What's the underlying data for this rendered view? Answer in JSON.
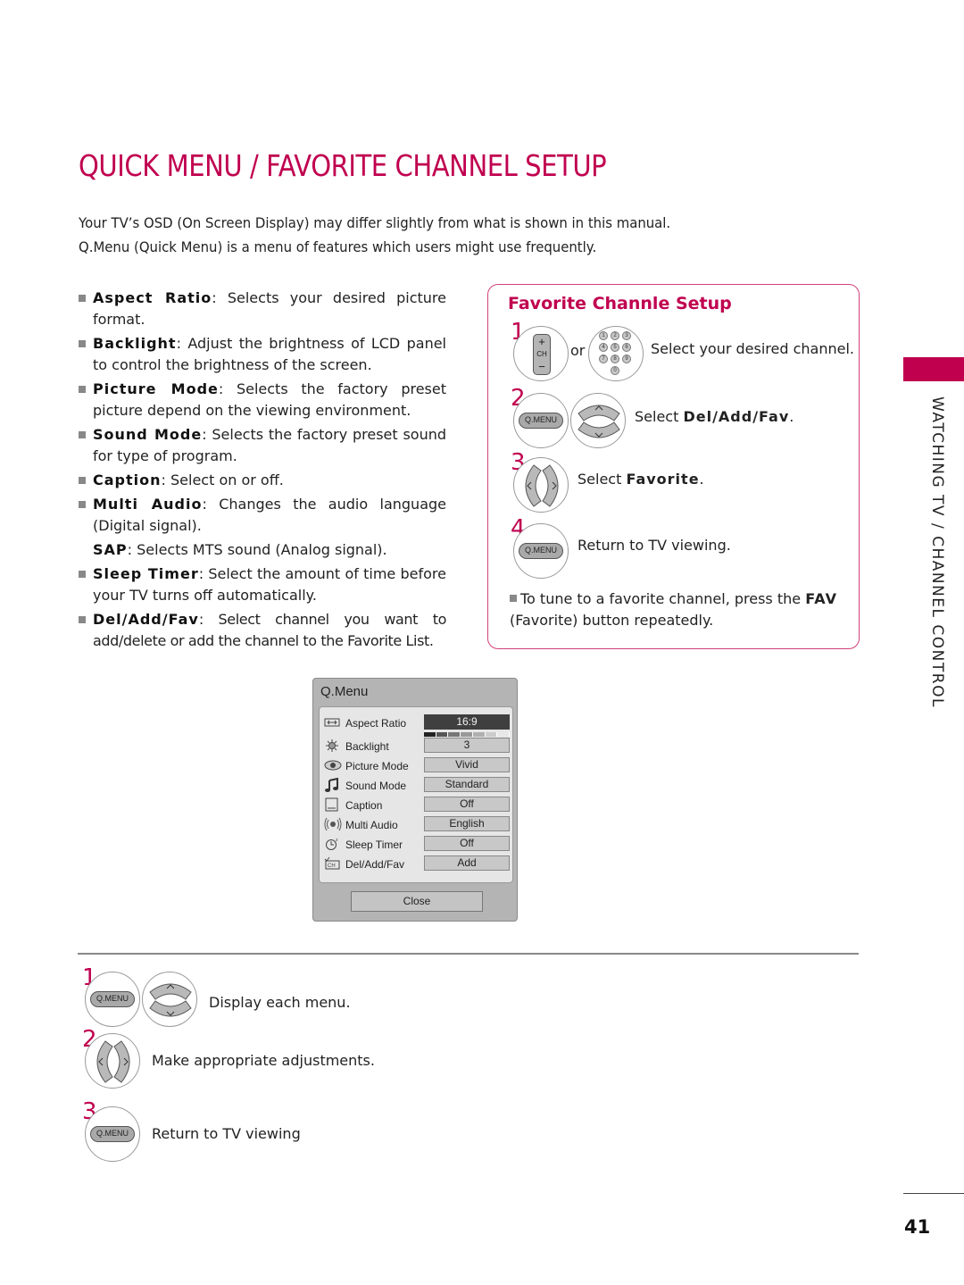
{
  "page": {
    "title": "QUICK MENU / FAVORITE CHANNEL SETUP",
    "intro": [
      "Your TV’s OSD (On Screen Display) may differ slightly from what is shown in this manual.",
      "Q.Menu (Quick Menu) is a menu of features which users might use frequently."
    ],
    "side_tab_label": "WATCHING TV / CHANNEL CONTROL",
    "accent_color": "#c0004f",
    "page_number": "41"
  },
  "features": [
    {
      "term": "Aspect Ratio",
      "desc": ": Selects your desired picture format."
    },
    {
      "term": "Backlight",
      "desc": ": Adjust the brightness of LCD panel to control the brightness of the screen."
    },
    {
      "term": "Picture Mode",
      "desc": ": Selects the factory preset picture depend on the viewing environment."
    },
    {
      "term": "Sound Mode",
      "desc": ": Selects the factory preset sound for type of program."
    },
    {
      "term": "Caption",
      "desc": ": Select on or off."
    },
    {
      "term": "Multi Audio",
      "desc": ": Changes the audio language (Digital signal)."
    },
    {
      "term": "SAP",
      "desc": ": Selects MTS sound (Analog signal)."
    },
    {
      "term": "Sleep Timer",
      "desc": ": Select the amount of time before your TV turns off automatically."
    },
    {
      "term": "Del/Add/Fav",
      "desc": ": Select channel you want to add/delete or add the channel to the Favorite List."
    }
  ],
  "favorite": {
    "title": "Favorite Channle Setup",
    "steps": [
      {
        "num": "1",
        "or": "or",
        "text": "Select your desired channel."
      },
      {
        "num": "2",
        "text_pre": "Select ",
        "text_bold": "Del/Add/Fav",
        "text_post": "."
      },
      {
        "num": "3",
        "text_pre": "Select ",
        "text_bold": "Favorite",
        "text_post": "."
      },
      {
        "num": "4",
        "text": "Return to TV viewing."
      }
    ],
    "note_pre": "To tune to a favorite channel, press the ",
    "note_bold": "FAV",
    "note_post": " (Favorite) button repeatedly.",
    "ch_plus": "+",
    "ch_label": "CH",
    "ch_minus": "−",
    "numpad": [
      "1",
      "2",
      "3",
      "4",
      "5",
      "6",
      "7",
      "8",
      "9",
      "0"
    ]
  },
  "remote": {
    "qmenu_label": "Q.MENU"
  },
  "qmenu": {
    "title": "Q.Menu",
    "rows": [
      {
        "icon": "aspect-ratio-icon",
        "label": "Aspect Ratio",
        "value": "16:9",
        "selected": true
      },
      {
        "icon": "backlight-icon",
        "label": "Backlight",
        "value": "3",
        "level": 3,
        "level_max": 7
      },
      {
        "icon": "picture-mode-icon",
        "label": "Picture Mode",
        "value": "Vivid"
      },
      {
        "icon": "sound-mode-icon",
        "label": "Sound Mode",
        "value": "Standard"
      },
      {
        "icon": "caption-icon",
        "label": "Caption",
        "value": "Off"
      },
      {
        "icon": "multi-audio-icon",
        "label": "Multi Audio",
        "value": "English"
      },
      {
        "icon": "sleep-timer-icon",
        "label": "Sleep Timer",
        "value": "Off"
      },
      {
        "icon": "del-add-fav-icon",
        "label": "Del/Add/Fav",
        "value": "Add"
      }
    ],
    "close_label": "Close"
  },
  "bottom_steps": [
    {
      "num": "1",
      "text": "Display each menu."
    },
    {
      "num": "2",
      "text": "Make appropriate adjustments."
    },
    {
      "num": "3",
      "text": "Return to TV viewing"
    }
  ]
}
